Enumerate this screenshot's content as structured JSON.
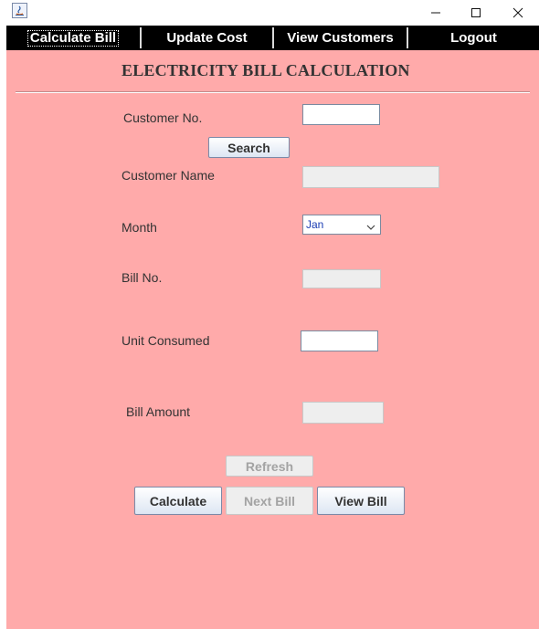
{
  "window": {
    "minimize_glyph": "—",
    "maximize_glyph": "☐",
    "close_glyph": "✕"
  },
  "menu": {
    "calculate_bill": "Calculate Bill",
    "update_cost": "Update Cost",
    "view_customers": "View Customers",
    "logout": "Logout"
  },
  "form": {
    "title": "ELECTRICITY BILL CALCULATION",
    "customer_no_label": "Customer No.",
    "customer_no_value": "",
    "search_button": "Search",
    "customer_name_label": "Customer Name",
    "customer_name_value": "",
    "month_label": "Month",
    "month_selected": "Jan",
    "bill_no_label": "Bill No.",
    "bill_no_value": "",
    "unit_consumed_label": "Unit Consumed",
    "unit_consumed_value": "",
    "bill_amount_label": "Bill Amount",
    "bill_amount_value": "",
    "refresh_button": "Refresh",
    "calculate_button": "Calculate",
    "next_bill_button": "Next Bill",
    "view_bill_button": "View Bill"
  },
  "colors": {
    "panel": "#ffaaaa",
    "menubar": "#000000"
  },
  "icons": {
    "app_icon": "java-icon",
    "dropdown_icon": "chevron-down-icon"
  }
}
